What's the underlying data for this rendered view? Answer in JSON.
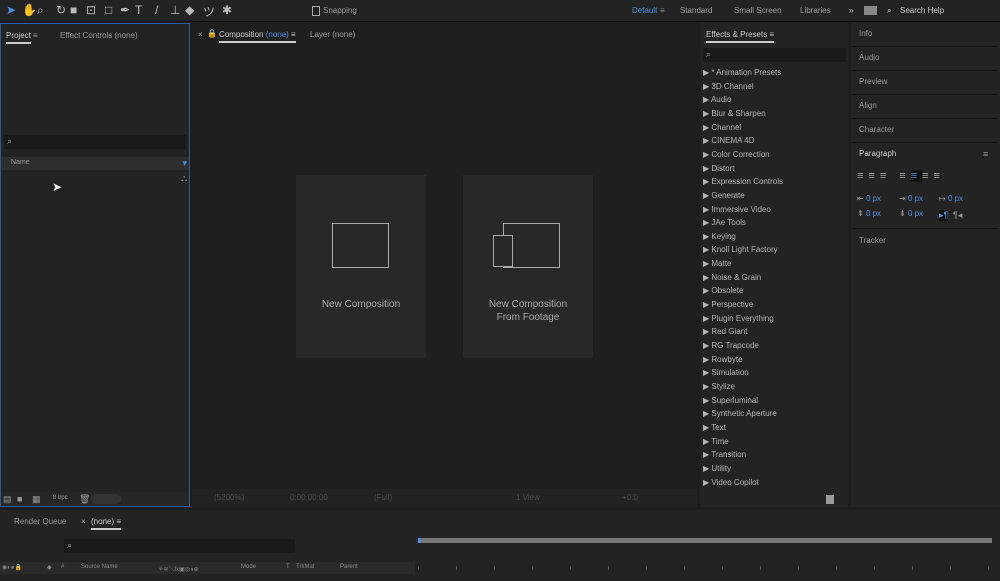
{
  "toolbar": {
    "snapping_label": "Snapping",
    "workspaces": [
      {
        "label": "Default",
        "active": true
      },
      {
        "label": "Standard"
      },
      {
        "label": "Small Screen"
      },
      {
        "label": "Libraries"
      }
    ],
    "more": "»",
    "search_placeholder": "Search Help"
  },
  "project": {
    "tabs": [
      "Project",
      "Effect Controls (none)"
    ],
    "column_name": "Name",
    "bpc": "8 bpc"
  },
  "composition": {
    "tab_prefix": "Composition",
    "tab_value": "(none)",
    "layer_tab": "Layer (none)",
    "new_comp": "New Composition",
    "new_comp_footage_1": "New Composition",
    "new_comp_footage_2": "From Footage",
    "zoom": "(5200%)",
    "timecode": "0:00:00:00",
    "resolution": "(Full)",
    "views": "1 View",
    "exposure": "+0.0"
  },
  "effects": {
    "title": "Effects & Presets",
    "items": [
      "* Animation Presets",
      "3D Channel",
      "Audio",
      "Blur & Sharpen",
      "Channel",
      "CINEMA 4D",
      "Color Correction",
      "Distort",
      "Expression Controls",
      "Generate",
      "Immersive Video",
      "JAe Tools",
      "Keying",
      "Knoll Light Factory",
      "Matte",
      "Noise & Grain",
      "Obsolete",
      "Perspective",
      "Plugin Everything",
      "Red Giant",
      "RG Trapcode",
      "Rowbyte",
      "Simulation",
      "Stylize",
      "Superluminal",
      "Synthetic Aperture",
      "Text",
      "Time",
      "Transition",
      "Utility",
      "Video Copilot"
    ]
  },
  "right": {
    "panels": [
      "Info",
      "Audio",
      "Preview",
      "Align",
      "Character"
    ],
    "paragraph": "Paragraph",
    "tracker": "Tracker",
    "px_values": [
      "0 px",
      "0 px",
      "0 px",
      "0 px",
      "0 px"
    ]
  },
  "timeline": {
    "tabs": [
      "Render Queue",
      "(none)"
    ],
    "columns": [
      "#",
      "Source Name",
      "Mode",
      "T",
      "TrkMat",
      "Parent"
    ]
  },
  "colors": {
    "accent": "#4b8fe0",
    "panel": "#232323",
    "background": "#1d1d1d"
  }
}
